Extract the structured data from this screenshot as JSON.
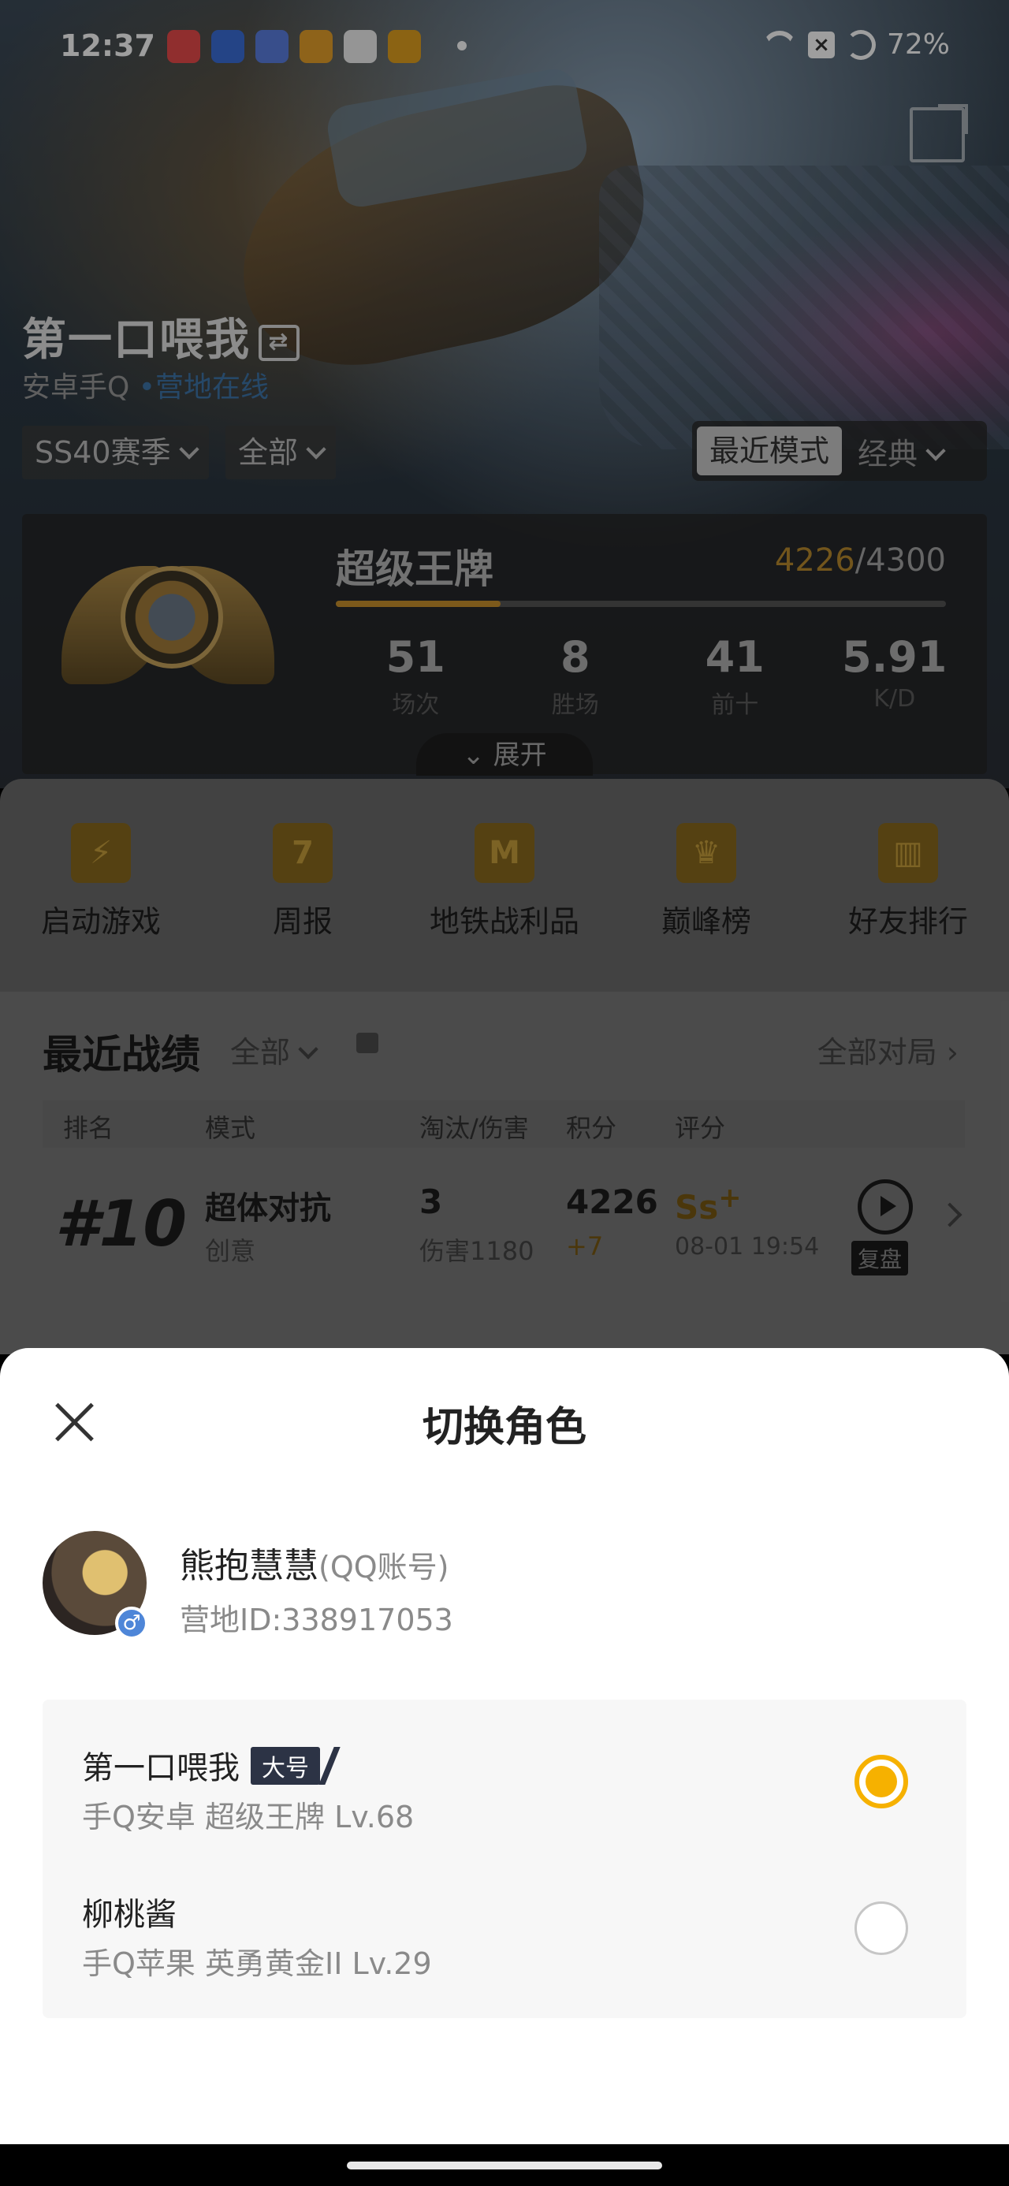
{
  "status_bar": {
    "time": "12:37",
    "battery": "72%",
    "app_icon_colors": [
      "#e94b4b",
      "#3b6ed8",
      "#5b7fe0",
      "#e6a02a",
      "#f0f0f0",
      "#e0a020"
    ]
  },
  "profile": {
    "player_name": "第一口喂我",
    "platform": "安卓手Q",
    "online_status": "营地在线",
    "season_filter": "SS40赛季",
    "scope_filter": "全部",
    "mode_toggle": {
      "active": "最近模式",
      "inactive": "经典"
    }
  },
  "rank_card": {
    "tier": "超级王牌",
    "score_current": "4226",
    "score_sep": "/",
    "score_max": "4300",
    "progress": 0.27,
    "stats": [
      {
        "value": "51",
        "label": "场次"
      },
      {
        "value": "8",
        "label": "胜场"
      },
      {
        "value": "41",
        "label": "前十"
      },
      {
        "value": "5.91",
        "label": "K/D"
      }
    ],
    "expand_label": "展开"
  },
  "quick_actions": [
    {
      "icon": "lightning-icon",
      "glyph": "⚡",
      "label": "启动游戏"
    },
    {
      "icon": "calendar-icon",
      "glyph": "7",
      "label": "周报"
    },
    {
      "icon": "metro-badge-icon",
      "glyph": "M",
      "label": "地铁战利品"
    },
    {
      "icon": "peak-trophy-icon",
      "glyph": "♛",
      "label": "巅峰榜"
    },
    {
      "icon": "podium-icon",
      "glyph": "▥",
      "label": "好友排行"
    }
  ],
  "recent": {
    "title": "最近战绩",
    "filter": "全部",
    "all_matches": "全部对局",
    "columns": [
      "排名",
      "模式",
      "淘汰/伤害",
      "积分",
      "评分"
    ],
    "rows": [
      {
        "rank": "#10",
        "mode": "超体对抗",
        "sub_mode": "创意",
        "kills": "3",
        "damage": "伤害1180",
        "points": "4226",
        "delta": "+7",
        "grade": "Ss",
        "grade_sup": "+",
        "datetime": "08-01 19:54",
        "replay": "复盘"
      }
    ]
  },
  "sheet": {
    "title": "切换角色",
    "account": {
      "name": "熊抱慧慧",
      "type_suffix": "(QQ账号)",
      "camp_id": "营地ID:338917053",
      "gender": "♂"
    },
    "roles": [
      {
        "name": "第一口喂我",
        "tag": "大号",
        "meta": "手Q安卓  超级王牌  Lv.68",
        "selected": true
      },
      {
        "name": "柳桃酱",
        "tag": "",
        "meta": "手Q苹果  英勇黄金II  Lv.29",
        "selected": false
      }
    ]
  }
}
